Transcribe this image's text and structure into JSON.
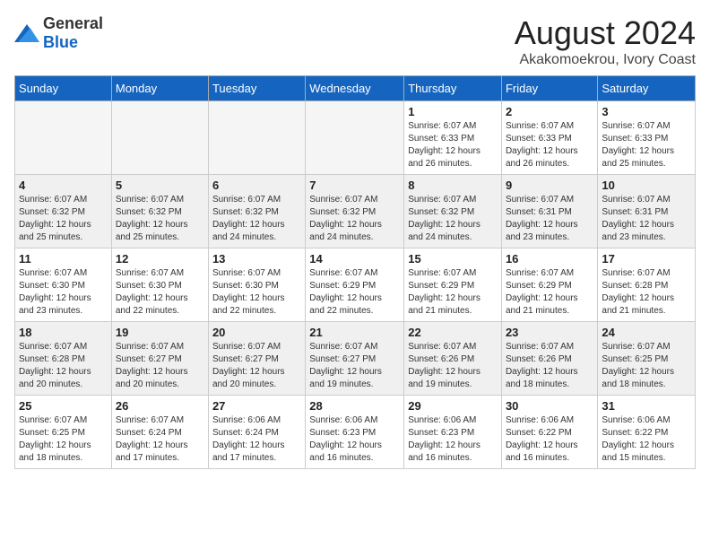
{
  "header": {
    "logo_general": "General",
    "logo_blue": "Blue",
    "month_year": "August 2024",
    "location": "Akakomoekrou, Ivory Coast"
  },
  "weekdays": [
    "Sunday",
    "Monday",
    "Tuesday",
    "Wednesday",
    "Thursday",
    "Friday",
    "Saturday"
  ],
  "weeks": [
    [
      {
        "day": "",
        "info": ""
      },
      {
        "day": "",
        "info": ""
      },
      {
        "day": "",
        "info": ""
      },
      {
        "day": "",
        "info": ""
      },
      {
        "day": "1",
        "info": "Sunrise: 6:07 AM\nSunset: 6:33 PM\nDaylight: 12 hours\nand 26 minutes."
      },
      {
        "day": "2",
        "info": "Sunrise: 6:07 AM\nSunset: 6:33 PM\nDaylight: 12 hours\nand 26 minutes."
      },
      {
        "day": "3",
        "info": "Sunrise: 6:07 AM\nSunset: 6:33 PM\nDaylight: 12 hours\nand 25 minutes."
      }
    ],
    [
      {
        "day": "4",
        "info": "Sunrise: 6:07 AM\nSunset: 6:32 PM\nDaylight: 12 hours\nand 25 minutes."
      },
      {
        "day": "5",
        "info": "Sunrise: 6:07 AM\nSunset: 6:32 PM\nDaylight: 12 hours\nand 25 minutes."
      },
      {
        "day": "6",
        "info": "Sunrise: 6:07 AM\nSunset: 6:32 PM\nDaylight: 12 hours\nand 24 minutes."
      },
      {
        "day": "7",
        "info": "Sunrise: 6:07 AM\nSunset: 6:32 PM\nDaylight: 12 hours\nand 24 minutes."
      },
      {
        "day": "8",
        "info": "Sunrise: 6:07 AM\nSunset: 6:32 PM\nDaylight: 12 hours\nand 24 minutes."
      },
      {
        "day": "9",
        "info": "Sunrise: 6:07 AM\nSunset: 6:31 PM\nDaylight: 12 hours\nand 23 minutes."
      },
      {
        "day": "10",
        "info": "Sunrise: 6:07 AM\nSunset: 6:31 PM\nDaylight: 12 hours\nand 23 minutes."
      }
    ],
    [
      {
        "day": "11",
        "info": "Sunrise: 6:07 AM\nSunset: 6:30 PM\nDaylight: 12 hours\nand 23 minutes."
      },
      {
        "day": "12",
        "info": "Sunrise: 6:07 AM\nSunset: 6:30 PM\nDaylight: 12 hours\nand 22 minutes."
      },
      {
        "day": "13",
        "info": "Sunrise: 6:07 AM\nSunset: 6:30 PM\nDaylight: 12 hours\nand 22 minutes."
      },
      {
        "day": "14",
        "info": "Sunrise: 6:07 AM\nSunset: 6:29 PM\nDaylight: 12 hours\nand 22 minutes."
      },
      {
        "day": "15",
        "info": "Sunrise: 6:07 AM\nSunset: 6:29 PM\nDaylight: 12 hours\nand 21 minutes."
      },
      {
        "day": "16",
        "info": "Sunrise: 6:07 AM\nSunset: 6:29 PM\nDaylight: 12 hours\nand 21 minutes."
      },
      {
        "day": "17",
        "info": "Sunrise: 6:07 AM\nSunset: 6:28 PM\nDaylight: 12 hours\nand 21 minutes."
      }
    ],
    [
      {
        "day": "18",
        "info": "Sunrise: 6:07 AM\nSunset: 6:28 PM\nDaylight: 12 hours\nand 20 minutes."
      },
      {
        "day": "19",
        "info": "Sunrise: 6:07 AM\nSunset: 6:27 PM\nDaylight: 12 hours\nand 20 minutes."
      },
      {
        "day": "20",
        "info": "Sunrise: 6:07 AM\nSunset: 6:27 PM\nDaylight: 12 hours\nand 20 minutes."
      },
      {
        "day": "21",
        "info": "Sunrise: 6:07 AM\nSunset: 6:27 PM\nDaylight: 12 hours\nand 19 minutes."
      },
      {
        "day": "22",
        "info": "Sunrise: 6:07 AM\nSunset: 6:26 PM\nDaylight: 12 hours\nand 19 minutes."
      },
      {
        "day": "23",
        "info": "Sunrise: 6:07 AM\nSunset: 6:26 PM\nDaylight: 12 hours\nand 18 minutes."
      },
      {
        "day": "24",
        "info": "Sunrise: 6:07 AM\nSunset: 6:25 PM\nDaylight: 12 hours\nand 18 minutes."
      }
    ],
    [
      {
        "day": "25",
        "info": "Sunrise: 6:07 AM\nSunset: 6:25 PM\nDaylight: 12 hours\nand 18 minutes."
      },
      {
        "day": "26",
        "info": "Sunrise: 6:07 AM\nSunset: 6:24 PM\nDaylight: 12 hours\nand 17 minutes."
      },
      {
        "day": "27",
        "info": "Sunrise: 6:06 AM\nSunset: 6:24 PM\nDaylight: 12 hours\nand 17 minutes."
      },
      {
        "day": "28",
        "info": "Sunrise: 6:06 AM\nSunset: 6:23 PM\nDaylight: 12 hours\nand 16 minutes."
      },
      {
        "day": "29",
        "info": "Sunrise: 6:06 AM\nSunset: 6:23 PM\nDaylight: 12 hours\nand 16 minutes."
      },
      {
        "day": "30",
        "info": "Sunrise: 6:06 AM\nSunset: 6:22 PM\nDaylight: 12 hours\nand 16 minutes."
      },
      {
        "day": "31",
        "info": "Sunrise: 6:06 AM\nSunset: 6:22 PM\nDaylight: 12 hours\nand 15 minutes."
      }
    ]
  ]
}
